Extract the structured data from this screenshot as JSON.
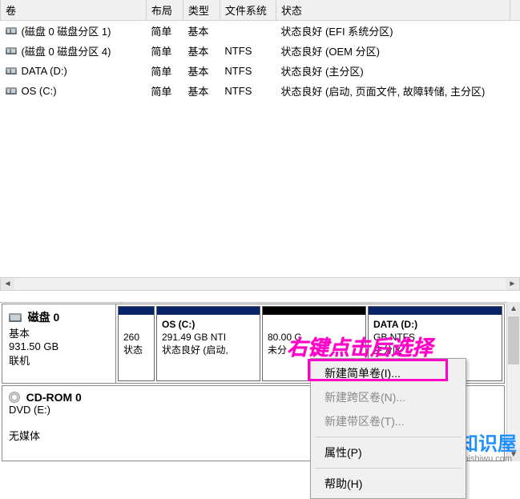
{
  "columns": {
    "volume": "卷",
    "layout": "布局",
    "type": "类型",
    "filesystem": "文件系统",
    "status": "状态"
  },
  "volumes": [
    {
      "name": "(磁盘 0 磁盘分区 1)",
      "layout": "简单",
      "type": "基本",
      "fs": "",
      "status": "状态良好 (EFI 系统分区)"
    },
    {
      "name": "(磁盘 0 磁盘分区 4)",
      "layout": "简单",
      "type": "基本",
      "fs": "NTFS",
      "status": "状态良好 (OEM 分区)"
    },
    {
      "name": "DATA (D:)",
      "layout": "简单",
      "type": "基本",
      "fs": "NTFS",
      "status": "状态良好 (主分区)"
    },
    {
      "name": "OS (C:)",
      "layout": "简单",
      "type": "基本",
      "fs": "NTFS",
      "status": "状态良好 (启动, 页面文件, 故障转储, 主分区)"
    }
  ],
  "disk0": {
    "title": "磁盘 0",
    "kind": "基本",
    "size": "931.50 GB",
    "state": "联机",
    "parts": [
      {
        "title": "",
        "line2": "260 ",
        "line3": "状态"
      },
      {
        "title": "OS  (C:)",
        "line2": "291.49 GB NTI",
        "line3": "状态良好 (启动,"
      },
      {
        "title": "",
        "line2": "80.00 G",
        "line3": "未分",
        "free": true
      },
      {
        "title": "DATA  (D:)",
        "line2": "GB NTFS",
        "line3": "主分区"
      }
    ]
  },
  "cdrom": {
    "title": "CD-ROM 0",
    "line1": "DVD (E:)",
    "line2": "无媒体"
  },
  "context_menu": {
    "new_simple": "新建简单卷(I)...",
    "new_spanned": "新建跨区卷(N)...",
    "new_striped": "新建带区卷(T)...",
    "properties": "属性(P)",
    "help": "帮助(H)"
  },
  "annotation": "右键点击后选择",
  "watermark": {
    "big": "知识屋",
    "small": "zhishiwu.com"
  }
}
